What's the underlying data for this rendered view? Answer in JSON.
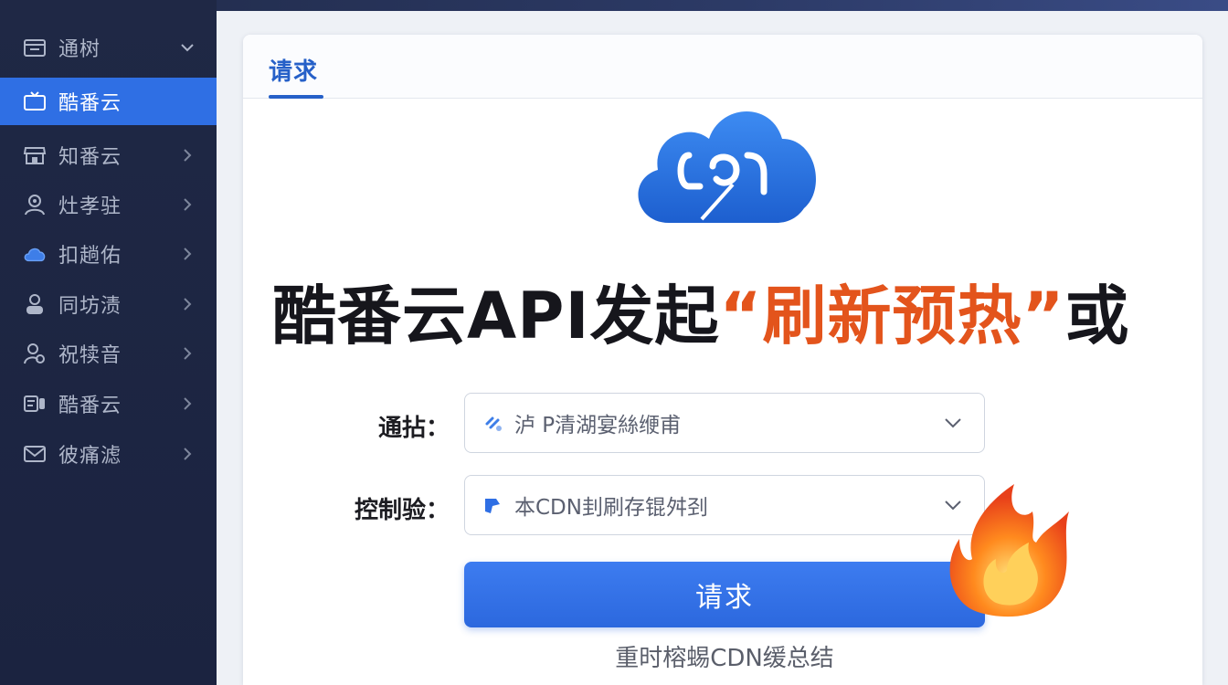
{
  "sidebar": {
    "items": [
      {
        "label": "通树",
        "icon": "folder-icon",
        "active": false,
        "chevron": "down"
      },
      {
        "label": "酷番云",
        "icon": "tv-icon",
        "active": true,
        "chevron": "none"
      },
      {
        "label": "知番云",
        "icon": "store-icon",
        "active": false,
        "chevron": "right"
      },
      {
        "label": "灶孝驻",
        "icon": "user-gear-icon",
        "active": false,
        "chevron": "right"
      },
      {
        "label": "扣趟佑",
        "icon": "cloud-icon",
        "active": false,
        "chevron": "right"
      },
      {
        "label": "同坊渍",
        "icon": "person-icon",
        "active": false,
        "chevron": "right"
      },
      {
        "label": "祝犊音",
        "icon": "person-search-icon",
        "active": false,
        "chevron": "right"
      },
      {
        "label": "酷番云",
        "icon": "badge-icon",
        "active": false,
        "chevron": "right"
      },
      {
        "label": "彼痛滤",
        "icon": "mail-icon",
        "active": false,
        "chevron": "right"
      }
    ]
  },
  "tab": {
    "label": "请求"
  },
  "headline": {
    "prefix": "酷番云API发起",
    "highlight": "“刷新预热”",
    "suffix": "或"
  },
  "form": {
    "field1": {
      "label": "通拈：",
      "value": "泸 P清湖宴絲缏甫",
      "icon": "link-icon"
    },
    "field2": {
      "label": "控制验：",
      "value": "本CDN刲刷存锟舛刭",
      "icon": "tag-icon"
    },
    "submit_label": "请求"
  },
  "footer": {
    "text": "重时榕蜴CDN缓总结"
  },
  "colors": {
    "sidebar_bg": "#1f2845",
    "active": "#2f6fe4",
    "accent": "#2660c8",
    "highlight": "#e3541c"
  }
}
